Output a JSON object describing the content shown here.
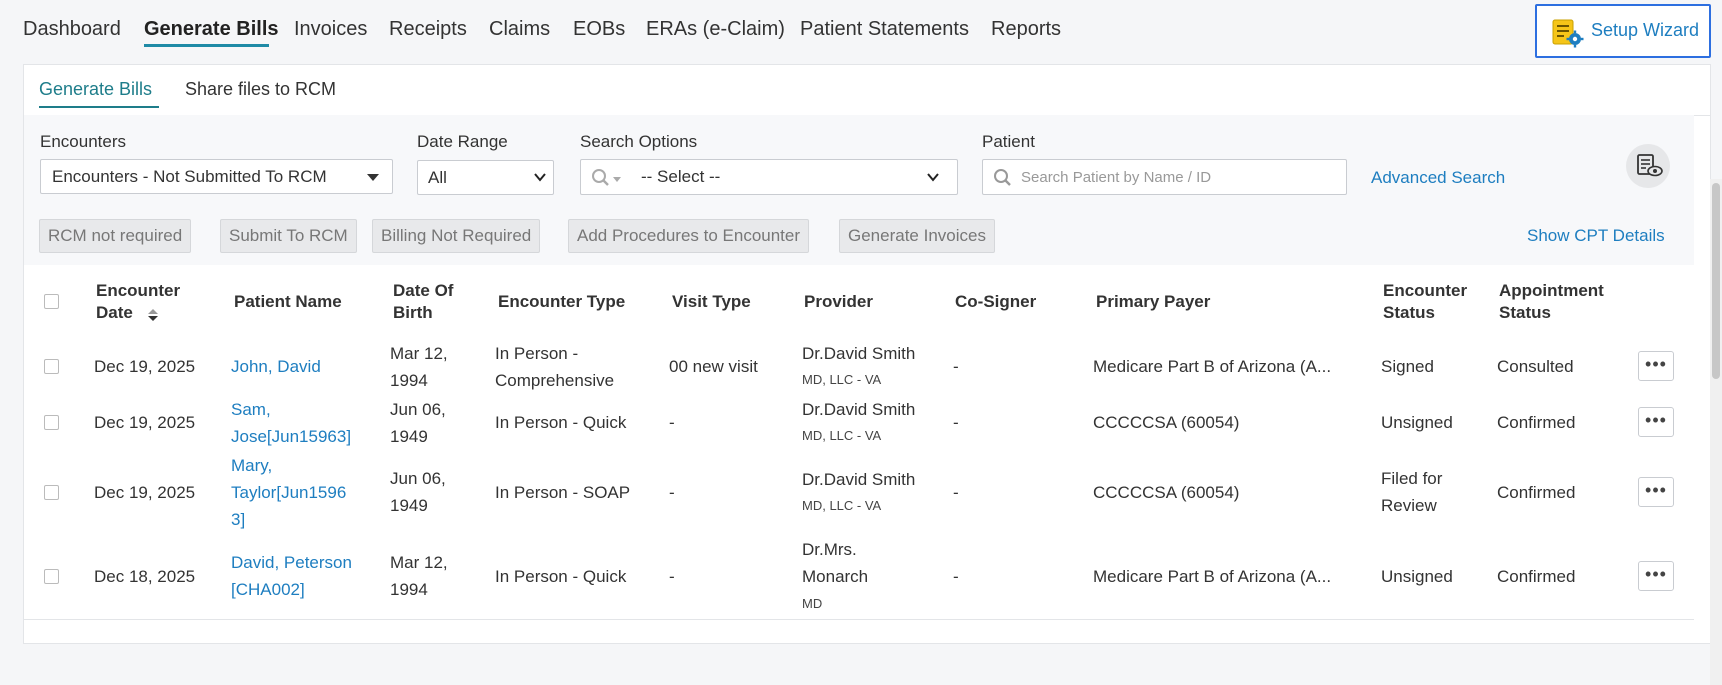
{
  "nav": {
    "tabs": [
      "Dashboard",
      "Generate Bills",
      "Invoices",
      "Receipts",
      "Claims",
      "EOBs",
      "ERAs (e-Claim)",
      "Patient Statements",
      "Reports"
    ],
    "active_tab": "Generate Bills",
    "setup_wizard": "Setup Wizard"
  },
  "subtabs": {
    "generate_bills": "Generate Bills",
    "share_files": "Share files to RCM"
  },
  "filters": {
    "encounters_label": "Encounters",
    "encounters_value": "Encounters - Not Submitted To RCM",
    "date_range_label": "Date Range",
    "date_range_value": "All",
    "search_options_label": "Search Options",
    "search_options_value": "-- Select --",
    "patient_label": "Patient",
    "patient_placeholder": "Search Patient by Name / ID",
    "advanced_search": "Advanced Search"
  },
  "actions": {
    "rcm_not_required": "RCM not required",
    "submit_to_rcm": "Submit To RCM",
    "billing_not_required": "Billing Not Required",
    "add_procedures": "Add Procedures to Encounter",
    "generate_invoices": "Generate Invoices",
    "show_cpt": "Show CPT Details"
  },
  "table": {
    "headers": {
      "encounter_date": [
        "Encounter",
        "Date"
      ],
      "patient_name": "Patient Name",
      "dob": [
        "Date Of",
        "Birth"
      ],
      "encounter_type": "Encounter Type",
      "visit_type": "Visit Type",
      "provider": "Provider",
      "co_signer": "Co-Signer",
      "primary_payer": "Primary Payer",
      "encounter_status": [
        "Encounter",
        "Status"
      ],
      "appointment_status": [
        "Appointment",
        "Status"
      ]
    },
    "rows": [
      {
        "date": "Dec 19, 2025",
        "patient": [
          "John, David"
        ],
        "dob": [
          "Mar 12,",
          "1994"
        ],
        "type": [
          "In Person -",
          "Comprehensive"
        ],
        "visit": "00 new visit",
        "provider": [
          "Dr.David Smith"
        ],
        "provider_sub": "MD, LLC - VA",
        "cosigner": "-",
        "payer": "Medicare Part B of Arizona (A...",
        "status": [
          "Signed"
        ],
        "appt": "Consulted",
        "more": "•••"
      },
      {
        "date": "Dec 19, 2025",
        "patient": [
          "Sam,",
          "Jose[Jun15963]"
        ],
        "dob": [
          "Jun 06,",
          "1949"
        ],
        "type": [
          "In Person - Quick"
        ],
        "visit": "-",
        "provider": [
          "Dr.David Smith"
        ],
        "provider_sub": "MD, LLC - VA",
        "cosigner": "-",
        "payer": "CCCCCSA (60054)",
        "status": [
          "Unsigned"
        ],
        "appt": "Confirmed",
        "more": "•••"
      },
      {
        "date": "Dec 19, 2025",
        "patient": [
          "Mary,",
          "Taylor[Jun1596",
          "3]"
        ],
        "dob": [
          "Jun 06,",
          "1949"
        ],
        "type": [
          "In Person - SOAP"
        ],
        "visit": "-",
        "provider": [
          "Dr.David Smith"
        ],
        "provider_sub": "MD, LLC - VA",
        "cosigner": "-",
        "payer": "CCCCCSA (60054)",
        "status": [
          "Filed for",
          "Review"
        ],
        "appt": "Confirmed",
        "more": "•••"
      },
      {
        "date": "Dec 18, 2025",
        "patient": [
          "David, Peterson",
          "[CHA002]"
        ],
        "dob": [
          "Mar 12,",
          "1994"
        ],
        "type": [
          "In Person - Quick"
        ],
        "visit": "-",
        "provider": [
          "Dr.Mrs.",
          "Monarch"
        ],
        "provider_sub": "MD",
        "cosigner": "-",
        "payer": "Medicare Part B of Arizona (A...",
        "status": [
          "Unsigned"
        ],
        "appt": "Confirmed",
        "more": "•••"
      }
    ]
  },
  "colors": {
    "accent": "#1e7ec0",
    "tab_active": "#1e7d8a",
    "wizard_border": "#2d6fe0"
  }
}
